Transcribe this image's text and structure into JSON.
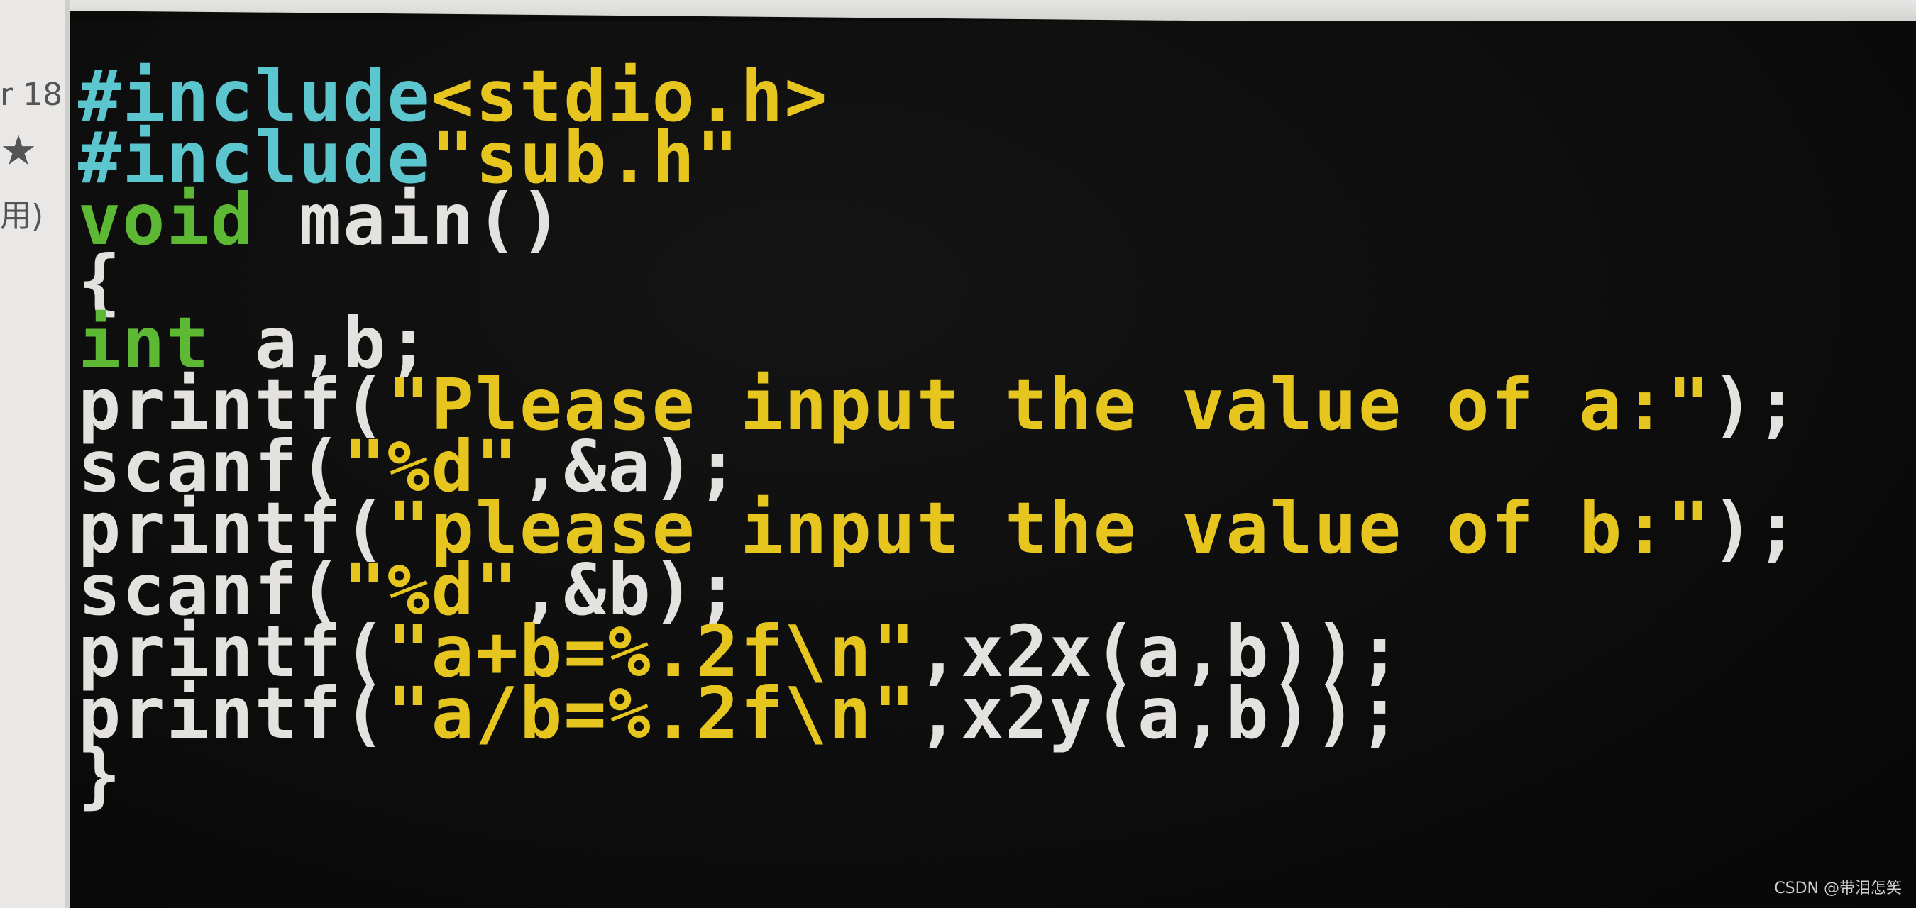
{
  "left_panel": {
    "fragment_1": "r 18",
    "star": "★",
    "fragment_2": "用)"
  },
  "code": {
    "lines": [
      [
        {
          "t": "#include",
          "c": "cyan"
        },
        {
          "t": "<stdio.h>",
          "c": "yellow"
        }
      ],
      [
        {
          "t": "#include",
          "c": "cyan"
        },
        {
          "t": "\"sub.h\"",
          "c": "yellow"
        }
      ],
      [
        {
          "t": "void",
          "c": "green"
        },
        {
          "t": " main()",
          "c": "white"
        }
      ],
      [
        {
          "t": "{",
          "c": "white"
        }
      ],
      [
        {
          "t": "int",
          "c": "green"
        },
        {
          "t": " a,b;",
          "c": "white"
        }
      ],
      [
        {
          "t": "printf(",
          "c": "white"
        },
        {
          "t": "\"Please input the value of a:\"",
          "c": "yellow"
        },
        {
          "t": ");",
          "c": "white"
        }
      ],
      [
        {
          "t": "scanf(",
          "c": "white"
        },
        {
          "t": "\"%d\"",
          "c": "yellow"
        },
        {
          "t": ",&a);",
          "c": "white"
        }
      ],
      [
        {
          "t": "printf(",
          "c": "white"
        },
        {
          "t": "\"please input the value of b:\"",
          "c": "yellow"
        },
        {
          "t": ");",
          "c": "white"
        }
      ],
      [
        {
          "t": "scanf(",
          "c": "white"
        },
        {
          "t": "\"%d\"",
          "c": "yellow"
        },
        {
          "t": ",&b);",
          "c": "white"
        }
      ],
      [
        {
          "t": "printf(",
          "c": "white"
        },
        {
          "t": "\"a+b=%.2f\\n\"",
          "c": "yellow"
        },
        {
          "t": ",x2x(a,b));",
          "c": "white"
        }
      ],
      [
        {
          "t": "printf(",
          "c": "white"
        },
        {
          "t": "\"a/b=%.2f\\n\"",
          "c": "yellow"
        },
        {
          "t": ",x2y(a,b));",
          "c": "white"
        }
      ],
      [
        {
          "t": "}",
          "c": "white"
        }
      ]
    ]
  },
  "colors": {
    "cyan": "#5cc6cf",
    "yellow": "#e6c61e",
    "green": "#5db833",
    "white": "#e4e2de",
    "background": "#0b0b0a"
  },
  "watermark": "CSDN @带泪怎笑"
}
